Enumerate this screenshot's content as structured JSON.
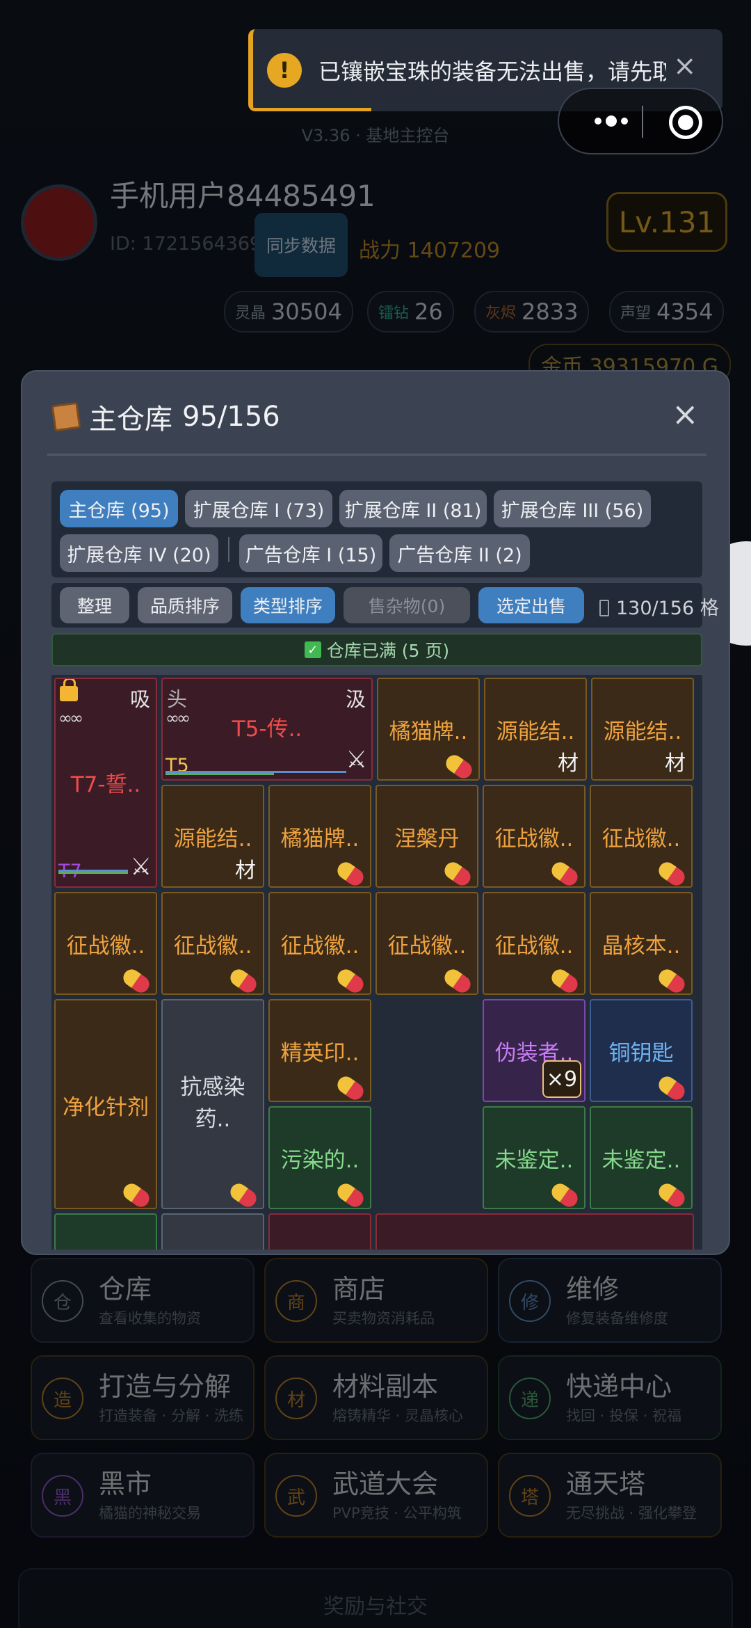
{
  "toast": {
    "icon": "warning-icon",
    "message": "已镶嵌宝珠的装备无法出售，请先取出",
    "close": "×"
  },
  "header": {
    "version": "V3.36 · 基地主控台",
    "username": "手机用户84485491",
    "user_id": "ID: 1721564369",
    "sync_label": "同步数据",
    "power": "战力 1407209",
    "level": "Lv.131"
  },
  "currencies": [
    {
      "label": "灵晶",
      "value": "30504",
      "color": "#8a97a8"
    },
    {
      "label": "镭钻",
      "value": "26",
      "color": "#2aa896"
    },
    {
      "label": "灰烬",
      "value": "2833",
      "color": "#b0662a"
    },
    {
      "label": "声望",
      "value": "4354",
      "color": "#8a97a8"
    }
  ],
  "gold": "金币 39315970 G",
  "modal": {
    "title": "主仓库",
    "count": "95/156",
    "close": "×",
    "tabs": [
      "主仓库 (95)",
      "扩展仓库 I (73)",
      "扩展仓库 II (81)",
      "扩展仓库 III (56)",
      "扩展仓库 IV (20)",
      "广告仓库 I (15)",
      "广告仓库 II (2)"
    ],
    "active_tab": 0,
    "toolbar": [
      "整理",
      "品质排序",
      "类型排序",
      "售杂物(0)",
      "选定出售"
    ],
    "capacity": "130/156 格",
    "full_notice": "仓库已满 (5 页)"
  },
  "items": {
    "big1": {
      "name": "T7-誓..",
      "corner": "吸",
      "tier": "T7"
    },
    "big2": {
      "name": "T5-传..",
      "head": "头",
      "corner": "汲",
      "tier": "T5"
    },
    "r1c3": "橘猫牌..",
    "r1c4": "源能结..",
    "r1c5": "源能结..",
    "r2c1": "源能结..",
    "r2c2": "橘猫牌..",
    "r2c3": "涅槃丹",
    "r2c4": "征战徽..",
    "r2c5": "征战徽..",
    "r3c0": "征战徽..",
    "r3c1": "征战徽..",
    "r3c2": "征战徽..",
    "r3c3": "征战徽..",
    "r3c4": "征战徽..",
    "r3c5": "晶核本..",
    "r4c0": "净化针剂",
    "r4c1": "抗感染药..",
    "r4c2": "精英印..",
    "r4c4": "伪装者..",
    "r4c4_count": "×9",
    "r4c5": "铜钥匙",
    "r5c2": "污染的..",
    "r5c4": "未鉴定..",
    "r5c5": "未鉴定..",
    "material_mark": "材",
    "infinity": "∞"
  },
  "menu": [
    {
      "icon": "仓",
      "title": "仓库",
      "sub": "查看收集的物资",
      "color": "#7d8799"
    },
    {
      "icon": "商",
      "title": "商店",
      "sub": "买卖物资消耗品",
      "color": "#b07a2a"
    },
    {
      "icon": "修",
      "title": "维修",
      "sub": "修复装备维修度",
      "color": "#5d86b8"
    },
    {
      "icon": "造",
      "title": "打造与分解",
      "sub": "打造装备 · 分解 · 洗练",
      "color": "#b07a2a"
    },
    {
      "icon": "材",
      "title": "材料副本",
      "sub": "熔铸精华 · 灵晶核心",
      "color": "#b07a2a"
    },
    {
      "icon": "递",
      "title": "快递中心",
      "sub": "找回 · 投保 · 祝福",
      "color": "#4fa068"
    },
    {
      "icon": "黑",
      "title": "黑市",
      "sub": "橘猫的神秘交易",
      "color": "#8a55c0"
    },
    {
      "icon": "武",
      "title": "武道大会",
      "sub": "PVP竞技 · 公平构筑",
      "color": "#b07a2a"
    },
    {
      "icon": "塔",
      "title": "通天塔",
      "sub": "无尽挑战 · 强化攀登",
      "color": "#b07a2a"
    }
  ],
  "footer": "奖励与社交"
}
